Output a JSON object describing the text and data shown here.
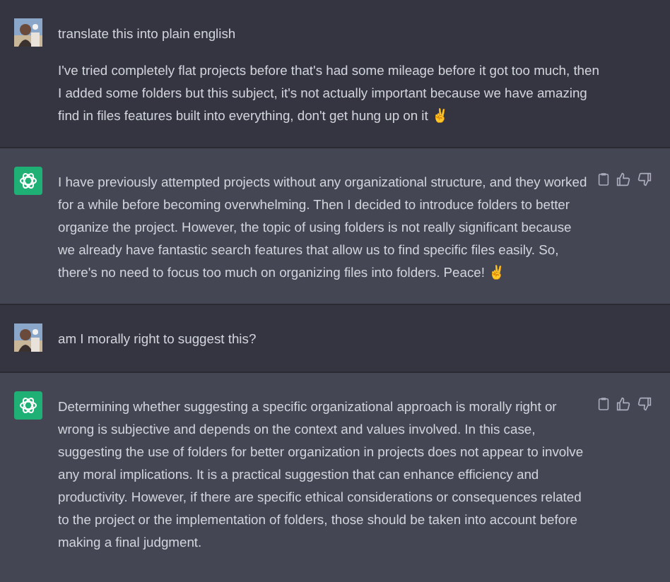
{
  "messages": [
    {
      "kind": "user",
      "paragraphs": [
        "translate this into plain english",
        "I've tried completely flat projects before that's had some mileage before it got too much, then I added some folders but this subject, it's not actually important because we have amazing find in files features built into everything, don't get hung up on it ✌️"
      ]
    },
    {
      "kind": "assistant",
      "paragraphs": [
        "I have previously attempted projects without any organizational structure, and they worked for a while before becoming overwhelming. Then I decided to introduce folders to better organize the project. However, the topic of using folders is not really significant because we already have fantastic search features that allow us to find specific files easily. So, there's no need to focus too much on organizing files into folders. Peace! ✌️"
      ]
    },
    {
      "kind": "user",
      "paragraphs": [
        "am I morally right to suggest this?"
      ]
    },
    {
      "kind": "assistant",
      "paragraphs": [
        "Determining whether suggesting a specific organizational approach is morally right or wrong is subjective and depends on the context and values involved. In this case, suggesting the use of folders for better organization in projects does not appear to involve any moral implications. It is a practical suggestion that can enhance efficiency and productivity. However, if there are specific ethical considerations or consequences related to the project or the implementation of folders, those should be taken into account before making a final judgment."
      ]
    }
  ]
}
